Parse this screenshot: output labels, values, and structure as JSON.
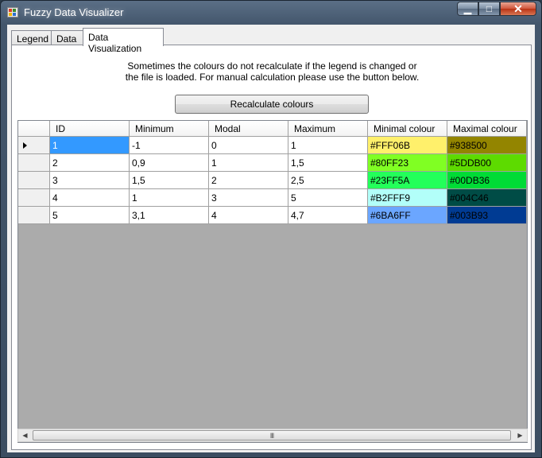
{
  "window": {
    "title": "Fuzzy Data Visualizer",
    "controls": {
      "minimize": "▁",
      "maximize": "□",
      "close": "✕"
    }
  },
  "tabs": [
    {
      "label": "Legend",
      "active": false
    },
    {
      "label": "Data",
      "active": false
    },
    {
      "label": "Data Visualization",
      "active": true
    }
  ],
  "info": {
    "line1": "Sometimes the colours do not recalculate if the legend is changed or",
    "line2": "the file is loaded. For manual calculation please use the button below."
  },
  "recalculate_button": "Recalculate colours",
  "grid": {
    "columns": [
      "ID",
      "Minimum",
      "Modal",
      "Maximum",
      "Minimal colour",
      "Maximal colour"
    ],
    "rows": [
      {
        "id": "1",
        "minimum": "-1",
        "modal": "0",
        "maximum": "1",
        "min_colour": "#FFF06B",
        "max_colour": "#938500",
        "current": true
      },
      {
        "id": "2",
        "minimum": "0,9",
        "modal": "1",
        "maximum": "1,5",
        "min_colour": "#80FF23",
        "max_colour": "#5DDB00",
        "current": false
      },
      {
        "id": "3",
        "minimum": "1,5",
        "modal": "2",
        "maximum": "2,5",
        "min_colour": "#23FF5A",
        "max_colour": "#00DB36",
        "current": false
      },
      {
        "id": "4",
        "minimum": "1",
        "modal": "3",
        "maximum": "5",
        "min_colour": "#B2FFF9",
        "max_colour": "#004C46",
        "current": false
      },
      {
        "id": "5",
        "minimum": "3,1",
        "modal": "4",
        "maximum": "4,7",
        "min_colour": "#6BA6FF",
        "max_colour": "#003B93",
        "current": false
      }
    ]
  },
  "scrollbar": {
    "left_arrow": "◀",
    "right_arrow": "▶",
    "grip": "III"
  },
  "colors": {
    "selection": "#3399FF",
    "grid_background": "#ABABAB"
  }
}
